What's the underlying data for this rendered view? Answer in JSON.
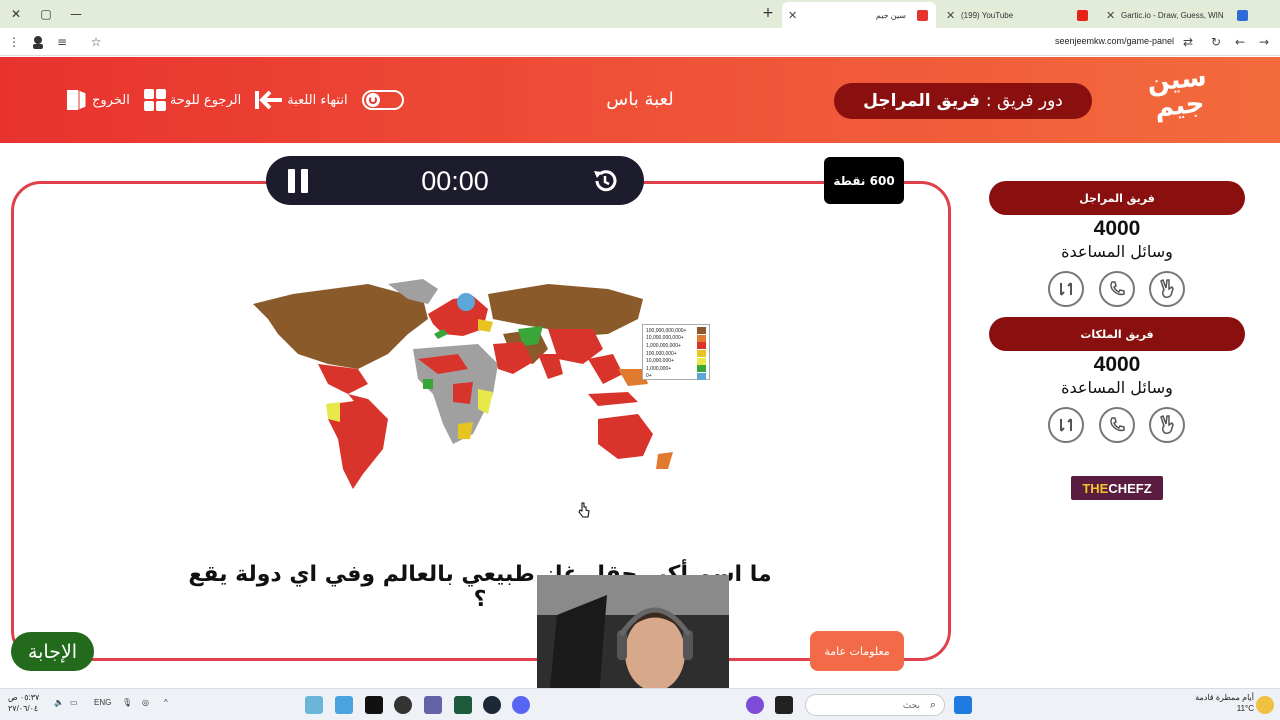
{
  "browser": {
    "tabs": [
      {
        "title": "Gartic.io - Draw, Guess, WIN",
        "favicon_color": "#2f6bd8"
      },
      {
        "title": "(199) YouTube",
        "favicon_color": "#e62117"
      },
      {
        "title": "سين جيم",
        "favicon_color": "#e8322e"
      }
    ],
    "new_tab_label": "+",
    "url": "seenjeemkw.com/game-panel"
  },
  "header": {
    "logo_line1": "سين",
    "logo_line2": "جيم",
    "turn_label": "دور فريق :",
    "turn_team": "فريق المراجل",
    "game_name": "لعبة باس",
    "end_game_label": "انتهاء اللعبة",
    "back_to_board_label": "الرجوع للوحة",
    "exit_label": "الخروج"
  },
  "question_panel": {
    "timer": "00:00",
    "points": "600 نقطة",
    "question": "ما اسم أكبر حقل غاز طبيعي بالعالم وفي اي دولة يقع ؟",
    "category": "معلومات عامة",
    "answer_label": "الإجابة",
    "map_legend": [
      "100,000,000,000+",
      "10,000,000,000+",
      "1,000,000,000+",
      "100,000,000+",
      "10,000,000+",
      "1,000,000+",
      "0+"
    ],
    "map_legend_colors": [
      "#8b5a2b",
      "#e07a2e",
      "#d9342b",
      "#e8c421",
      "#e7e84a",
      "#3aa63a",
      "#5aa7d8"
    ]
  },
  "teams": [
    {
      "name": "فريق المراجل",
      "score": "4000",
      "aids_label": "وسائل المساعدة"
    },
    {
      "name": "فريق الملكات",
      "score": "4000",
      "aids_label": "وسائل المساعدة"
    }
  ],
  "sponsor": {
    "part1": "THE",
    "part2": "CHEFZ"
  },
  "taskbar": {
    "search_placeholder": "بحث",
    "lang": "ENG",
    "time": "٠٥:٣٧ ص",
    "date": "٢٧/٠٦/٠٤",
    "weather_line1": "أيام ممطرة قادمة",
    "weather_line2": "11°C"
  }
}
